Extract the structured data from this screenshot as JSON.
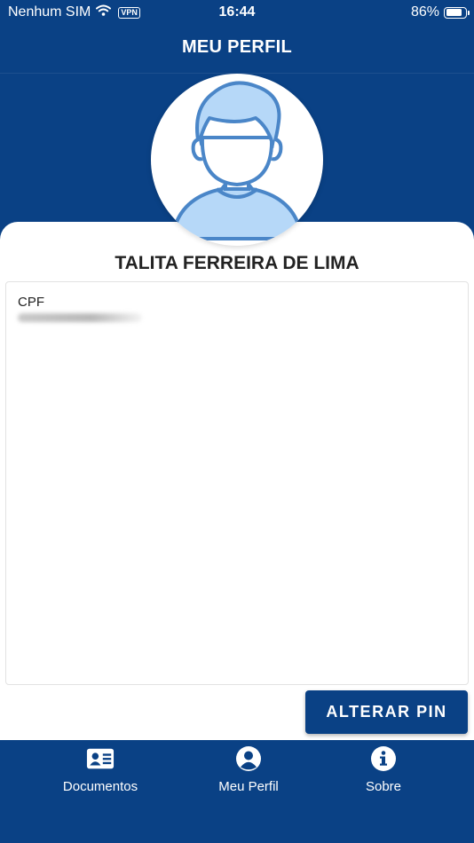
{
  "status_bar": {
    "carrier": "Nenhum SIM",
    "vpn": "VPN",
    "time": "16:44",
    "battery": "86%",
    "battery_level": 0.86
  },
  "header": {
    "title": "MEU PERFIL"
  },
  "profile": {
    "name": "TALITA FERREIRA DE LIMA",
    "cpf_label": "CPF"
  },
  "actions": {
    "alterar_pin": "ALTERAR PIN"
  },
  "bottom_nav": {
    "items": [
      {
        "label": "Documentos",
        "icon": "id-card-icon"
      },
      {
        "label": "Meu Perfil",
        "icon": "user-circle-icon"
      },
      {
        "label": "Sobre",
        "icon": "info-circle-icon"
      }
    ]
  },
  "colors": {
    "brand": "#0a4185",
    "avatar_fill": "#b6d8f8",
    "avatar_stroke": "#4a86c8"
  }
}
